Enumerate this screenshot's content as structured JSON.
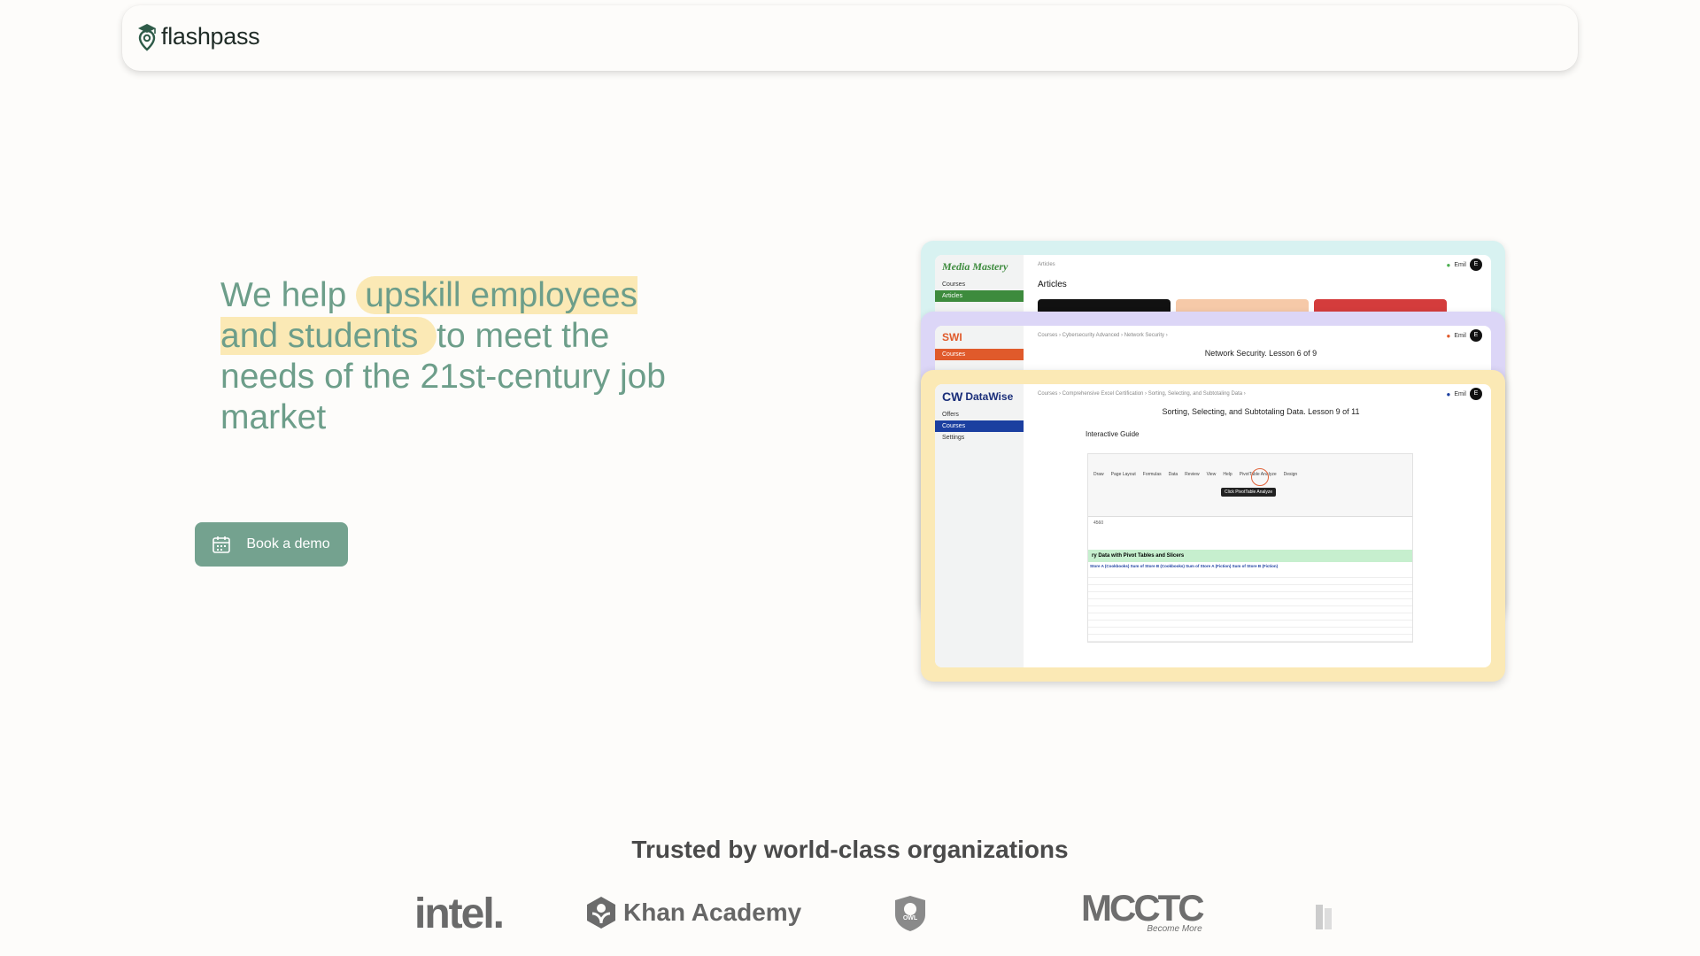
{
  "nav": {
    "brand": "flashpass"
  },
  "hero": {
    "headline_pre": "We help ",
    "headline_highlight": "upskill employees and students ",
    "headline_post": "to meet the needs of the 21st-century job market",
    "cta_label": "Book a demo"
  },
  "preview": {
    "back": {
      "brand": "Media Mastery",
      "menu": [
        "Courses",
        "Articles"
      ],
      "breadcrumb": "Articles",
      "title": "Articles",
      "user": "Emil",
      "avatar": "E"
    },
    "mid": {
      "brand": "SWI",
      "menu": [
        "Courses"
      ],
      "breadcrumb": "Courses  ›  Cybersecurity Advanced  ›  Network Security  ›",
      "title": "Network Security. Lesson 6 of 9",
      "user": "Emil",
      "avatar": "E"
    },
    "front": {
      "brand": "DataWise",
      "menu": [
        "Offers",
        "Courses",
        "Settings"
      ],
      "breadcrumb": "Courses  ›  Comprehensive Excel Certification  ›  Sorting, Selecting, and Subtotaling Data  ›",
      "title": "Sorting, Selecting, and Subtotaling Data. Lesson 9 of 11",
      "subtitle": "Interactive Guide",
      "user": "Emil",
      "avatar": "E",
      "sheet": {
        "ribbon_tabs": [
          "Draw",
          "Page Layout",
          "Formulas",
          "Data",
          "Review",
          "View",
          "Help",
          "PivotTable Analyze",
          "Design"
        ],
        "tooltip": "Click PivotTable Analyze",
        "cell_ref": "4560",
        "green_row": "ry Data with Pivot Tables and Slicers",
        "headers": "Store A (Cookbooks)   Sum of Store B (Cookbooks)   Sum of Store A (Fiction)   Sum of Store B (Fiction)"
      }
    },
    "colors": {
      "back": "#d8f2f1",
      "mid": "#dcd6f7",
      "front": "#fbe9b5"
    }
  },
  "trusted": {
    "title": "Trusted by world-class organizations",
    "logos": [
      "intel.",
      "Khan Academy",
      "OWL",
      "MCCTC",
      "Become More"
    ]
  },
  "colors": {
    "accent": "#74a28f",
    "headline": "#6d9e8a",
    "highlight": "#fbe9b5"
  }
}
